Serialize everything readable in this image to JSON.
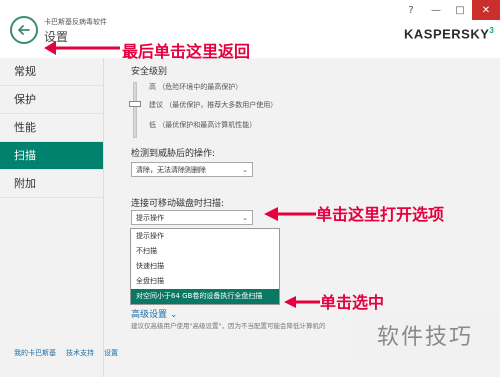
{
  "header": {
    "app_name": "卡巴斯基反病毒软件",
    "page_title": "设置",
    "help": "?",
    "minimize": "—",
    "maximize": "□",
    "close": "✕",
    "logo": "KASPERSKY",
    "logo_sup": "3"
  },
  "sidebar": {
    "items": [
      {
        "label": "常规"
      },
      {
        "label": "保护"
      },
      {
        "label": "性能"
      },
      {
        "label": "扫描",
        "active": true
      },
      {
        "label": "附加"
      }
    ]
  },
  "content": {
    "security_level_title": "安全级别",
    "levels": [
      {
        "label": "高 （危险环境中的最高保护）"
      },
      {
        "label": "建议 （最优保护，推荐大多数用户使用）"
      },
      {
        "label": "低 （最优保护和最高计算机性能）"
      }
    ],
    "threat_action_title": "检测到威胁后的操作:",
    "threat_action_value": "清除，无法清除则删除",
    "removable_title": "连接可移动磁盘时扫描:",
    "removable_value": "提示操作",
    "options": [
      {
        "label": "提示操作"
      },
      {
        "label": "不扫描"
      },
      {
        "label": "快速扫描"
      },
      {
        "label": "全盘扫描"
      },
      {
        "label": "对空间小于64 GB卷的设备执行全盘扫描",
        "selected": true
      }
    ],
    "advanced_link": "高级设置",
    "advanced_desc": "建议仅高级用户使用\"高级设置\"，因为不当配置可能会降低计算机的"
  },
  "footer": {
    "links": [
      "我的卡巴斯基",
      "技术支持",
      "设置"
    ]
  },
  "annotations": {
    "back_hint": "最后单击这里返回",
    "open_hint": "单击这里打开选项",
    "select_hint": "单击选中",
    "color": "#e5003f"
  },
  "watermark": "软件技巧",
  "colors": {
    "accent": "#00826e",
    "link": "#1a6fa8",
    "close": "#c9302c"
  }
}
